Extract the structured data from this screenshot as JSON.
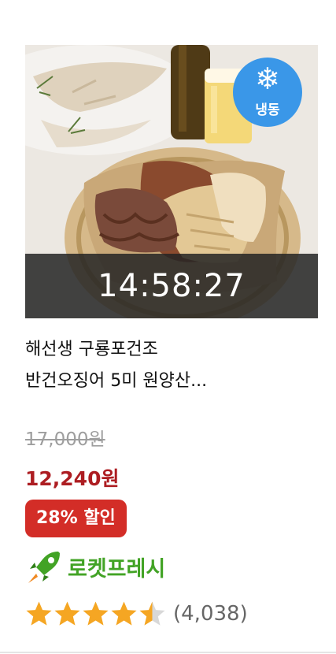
{
  "product": {
    "title_line1": "해선생 구룡포건조",
    "title_line2": "반건오징어 5미 원양산...",
    "frozen_badge": "냉동",
    "timer": "14:58:27",
    "original_price": "17,000원",
    "sale_price": "12,240원",
    "discount": "28% 할인",
    "delivery_badge": "로켓프레시",
    "rating": 4.5,
    "rating_max": 5,
    "review_count": "(4,038)"
  },
  "icons": {
    "frozen": "snowflake-icon",
    "delivery": "rocket-icon",
    "rating": "star-icon"
  },
  "colors": {
    "sale_price": "#ad1d22",
    "discount_bg": "#d32d27",
    "rocket_green": "#42a325",
    "frozen_blue": "#3a97e8",
    "star": "#f5a623"
  }
}
